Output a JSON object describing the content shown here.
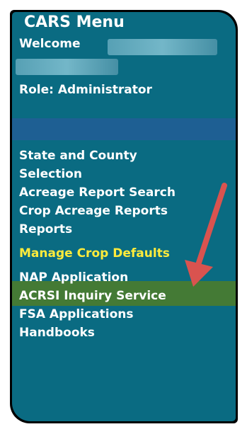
{
  "menu": {
    "title": "CARS Menu",
    "welcome_label": "Welcome",
    "role": "Role: Administrator",
    "items": [
      {
        "label": "State and County Selection"
      },
      {
        "label": "Acreage Report Search"
      },
      {
        "label": "Crop Acreage Reports"
      },
      {
        "label": "Reports"
      },
      {
        "label": "Manage Crop Defaults",
        "highlighted": true
      },
      {
        "label": "NAP Application"
      },
      {
        "label": "ACRSI Inquiry Service"
      },
      {
        "label": "FSA Applications"
      },
      {
        "label": "Handbooks"
      }
    ]
  },
  "colors": {
    "panel_bg": "#0a6b82",
    "separator_bar": "#1e5f93",
    "highlight_bg": "#447a35",
    "highlight_text": "#ffeb3b",
    "arrow": "#d9534f"
  },
  "annotation": {
    "icon": "red-arrow-icon"
  }
}
